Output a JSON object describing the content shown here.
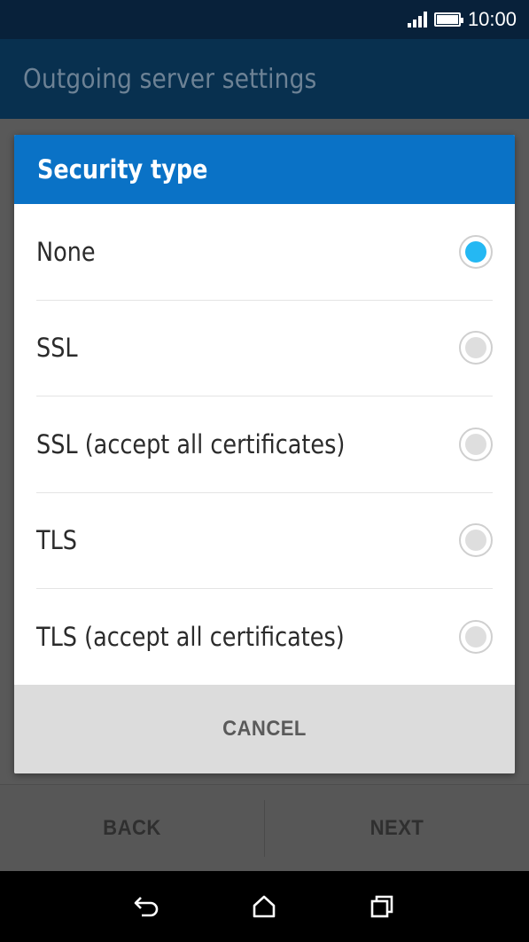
{
  "status_bar": {
    "time": "10:00",
    "icons": [
      "signal-icon",
      "battery-icon"
    ]
  },
  "app_bar": {
    "title": "Outgoing server settings"
  },
  "dialog": {
    "title": "Security type",
    "options": [
      {
        "label": "None",
        "selected": true
      },
      {
        "label": "SSL",
        "selected": false
      },
      {
        "label": "SSL (accept all certificates)",
        "selected": false
      },
      {
        "label": "TLS",
        "selected": false
      },
      {
        "label": "TLS (accept all certificates)",
        "selected": false
      }
    ],
    "cancel_label": "CANCEL"
  },
  "bottom_actions": {
    "back_label": "BACK",
    "next_label": "NEXT"
  },
  "nav_bar": {
    "icons": [
      "back-icon",
      "home-icon",
      "recents-icon"
    ]
  },
  "colors": {
    "accent": "#0a72c6",
    "radio_selected": "#24b8f3",
    "status_bar": "#08213a",
    "app_bar": "#08304f"
  }
}
